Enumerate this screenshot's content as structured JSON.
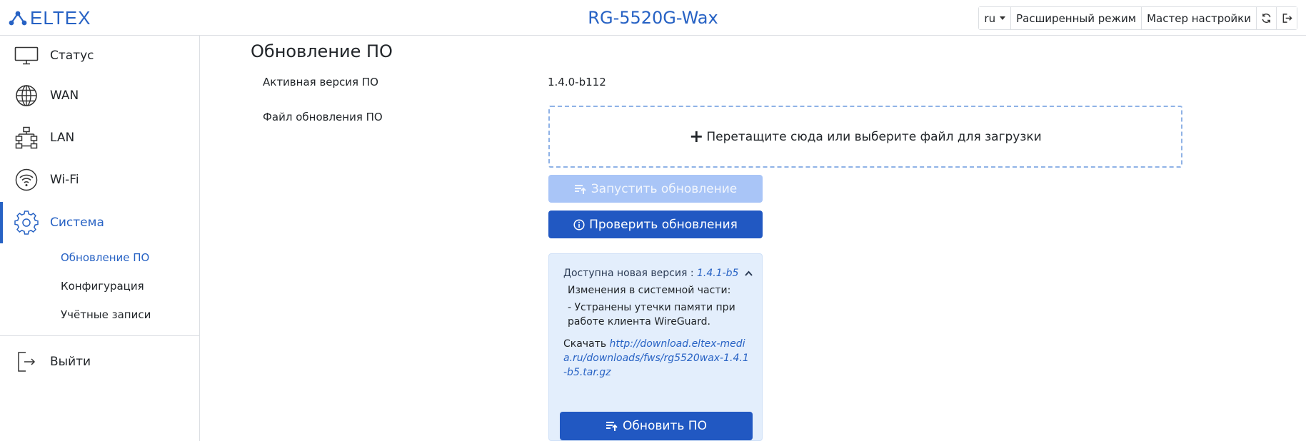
{
  "header": {
    "logo_text": "ELTEX",
    "device_title": "RG-5520G-Wax",
    "language": "ru",
    "advanced_mode_label": "Расширенный режим",
    "wizard_label": "Мастер настройки",
    "refresh_icon": "refresh-icon",
    "logout_icon": "logout-icon"
  },
  "sidebar": {
    "items": [
      {
        "label": "Статус",
        "icon": "monitor-icon"
      },
      {
        "label": "WAN",
        "icon": "globe-icon"
      },
      {
        "label": "LAN",
        "icon": "network-icon"
      },
      {
        "label": "Wi-Fi",
        "icon": "wifi-icon"
      },
      {
        "label": "Система",
        "icon": "gear-icon",
        "active": true
      }
    ],
    "subitems": [
      {
        "label": "Обновление ПО",
        "active": true
      },
      {
        "label": "Конфигурация"
      },
      {
        "label": "Учётные записи"
      }
    ],
    "logout_label": "Выйти",
    "accent_color": "#2762c4"
  },
  "main": {
    "title": "Обновление ПО",
    "active_version_label": "Активная версия ПО",
    "active_version_value": "1.4.0-b112",
    "update_file_label": "Файл обновления ПО",
    "dropzone_text": "Перетащите сюда или выберите файл для загрузки",
    "start_update_label": "Запустить обновление",
    "check_updates_label": "Проверить обновления",
    "card": {
      "available_label": "Доступна новая версия :",
      "available_version": "1.4.1-b5",
      "changes_heading": "Изменения в системной части:",
      "changes_text": "- Устранены утечки памяти при работе клиента WireGuard.",
      "download_label": "Скачать",
      "download_link": "http://download.eltex-media.ru/downloads/fws/rg5520wax-1.4.1-b5.tar.gz",
      "update_button_label": "Обновить ПО"
    }
  }
}
